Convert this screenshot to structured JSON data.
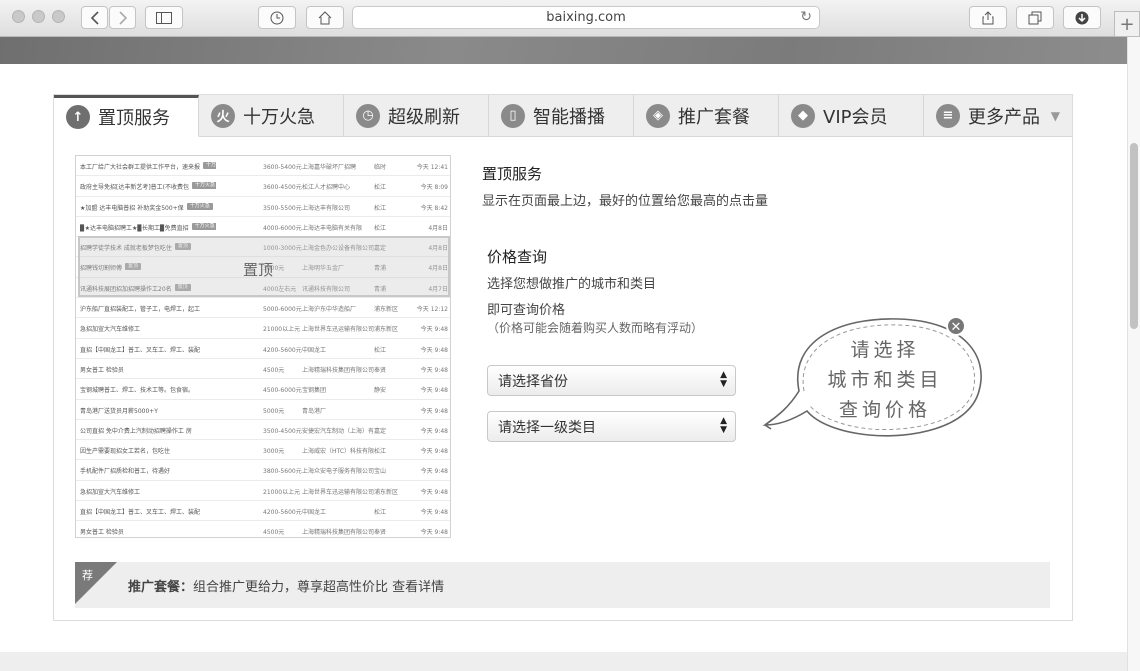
{
  "browser": {
    "address": "baixing.com"
  },
  "tabs": [
    {
      "label": "置顶服务",
      "icon": "arrow-up-circle-icon",
      "glyph": "↑",
      "active": true
    },
    {
      "label": "十万火急",
      "icon": "flame-icon",
      "glyph": "火",
      "active": false
    },
    {
      "label": "超级刷新",
      "icon": "clock-refresh-icon",
      "glyph": "◷",
      "active": false
    },
    {
      "label": "智能播播",
      "icon": "phone-icon",
      "glyph": "▯",
      "active": false
    },
    {
      "label": "推广套餐",
      "icon": "package-icon",
      "glyph": "◈",
      "active": false
    },
    {
      "label": "VIP会员",
      "icon": "diamond-icon",
      "glyph": "◆",
      "active": false
    },
    {
      "label": "更多产品",
      "icon": "list-icon",
      "glyph": "≡",
      "active": false
    }
  ],
  "preview": {
    "highlight_label": "置顶",
    "rows": [
      {
        "title": "本工厂给广大社会群工提供工作平台，速来报",
        "tag": "十万火急",
        "salary": "3600-5400元",
        "company": "上海嘉华破坏厂招聘",
        "type": "临时",
        "time": "今天 12:41"
      },
      {
        "title": "政府主导免招[达丰新艺考]普工(不收费包",
        "tag": "十万火急",
        "salary": "3600-4500元",
        "company": "松江人才招聘中心",
        "type": "松江",
        "time": "今天 8:09"
      },
      {
        "title": "★加盟 达丰电脑普招 补助奖金500+保",
        "tag": "十万火急",
        "salary": "3500-5500元",
        "company": "上海达丰有限公司",
        "type": "松江",
        "time": "今天 8:42"
      },
      {
        "title": "▉★达丰电脑招聘工★▉长期工▉免费直招",
        "tag": "十万火急",
        "salary": "4000-6000元",
        "company": "上海达丰电脑有关有限",
        "type": "松江",
        "time": "4月8日"
      },
      {
        "title": "招聘学徒学技术 成就老板梦包吃住",
        "tag": "置顶",
        "salary": "1000-3000元",
        "company": "上海金色办公设备有限公司",
        "type": "嘉定",
        "time": "4月8日"
      },
      {
        "title": "招聘钱切割师傅",
        "tag": "置顶",
        "salary": "3000元",
        "company": "上海明华五金厂",
        "type": "青浦",
        "time": "4月8日"
      },
      {
        "title": "讯通科技展团招加招聘操作工20名",
        "tag": "置顶",
        "salary": "4000左右元",
        "company": "讯通科技有限公司",
        "type": "青浦",
        "time": "4月7日"
      },
      {
        "title": "沪东船厂直招装配工，管子工，电焊工，起工",
        "tag": "",
        "salary": "5000-6000元",
        "company": "上海沪东中华造船厂",
        "type": "浦东新区",
        "time": "今天 12:12"
      },
      {
        "title": "急招加宣大汽车维修工",
        "tag": "",
        "salary": "21000以上元",
        "company": "上海世界车迅运输有限公司",
        "type": "浦东新区",
        "time": "今天 9:48"
      },
      {
        "title": "直招【中国龙工】普工、叉车工、焊工、装配",
        "tag": "",
        "salary": "4200-5600元",
        "company": "中国龙工",
        "type": "松江",
        "time": "今天 9:48"
      },
      {
        "title": "男女普工 检验员",
        "tag": "",
        "salary": "4500元",
        "company": "上海精瑞科技集团有限公司",
        "type": "奉贤",
        "time": "今天 9:48"
      },
      {
        "title": "宝钢城聘普工、焊工、技术工等。包食宿。",
        "tag": "",
        "salary": "4500-6000元",
        "company": "宝钢集团",
        "type": "静安",
        "time": "今天 9:48"
      },
      {
        "title": "青岛港厂送货员月薪5000+Y",
        "tag": "",
        "salary": "5000元",
        "company": "青岛港厂",
        "type": "",
        "time": "今天 9:48"
      },
      {
        "title": "公司直招 免中介费上汽制动招聘操作工 房",
        "tag": "",
        "salary": "3500-4500元",
        "company": "安捷宏汽车制动（上海）有",
        "type": "嘉定",
        "time": "今天 9:48"
      },
      {
        "title": "因生产需要现招女工若名，包吃住",
        "tag": "",
        "salary": "3000元",
        "company": "上海威宏（HTC）科技有限",
        "type": "松江",
        "time": "今天 9:48"
      },
      {
        "title": "手机配件厂招质检和普工，待遇好",
        "tag": "",
        "salary": "3800-5600元",
        "company": "上海众安电子服务有限公司",
        "type": "宝山",
        "time": "今天 9:48"
      },
      {
        "title": "急招加宣大汽车维修工",
        "tag": "",
        "salary": "21000以上元",
        "company": "上海世界车迅运输有限公司",
        "type": "浦东新区",
        "time": "今天 9:48"
      },
      {
        "title": "直招【中国龙工】普工、叉车工、焊工、装配",
        "tag": "",
        "salary": "4200-5600元",
        "company": "中国龙工",
        "type": "松江",
        "time": "今天 9:48"
      },
      {
        "title": "男女普工 检验员",
        "tag": "",
        "salary": "4500元",
        "company": "上海精瑞科技集团有限公司",
        "type": "奉贤",
        "time": "今天 9:48"
      }
    ]
  },
  "service": {
    "title": "置顶服务",
    "description": "显示在页面最上边，最好的位置给您最高的点击量"
  },
  "price_query": {
    "title": "价格查询",
    "line1": "选择您想做推广的城市和类目",
    "line2": "即可查询价格",
    "note": "（价格可能会随着购买人数而略有浮动）",
    "province_select": "请选择省份",
    "category_select": "请选择一级类目"
  },
  "bubble": {
    "line1": "请选择",
    "line2": "城市和类目",
    "line3": "查询价格",
    "close_glyph": "✕"
  },
  "recommend": {
    "corner": "荐",
    "label": "推广套餐：",
    "text": "组合推广更给力，尊享超高性价比",
    "link": "查看详情"
  }
}
